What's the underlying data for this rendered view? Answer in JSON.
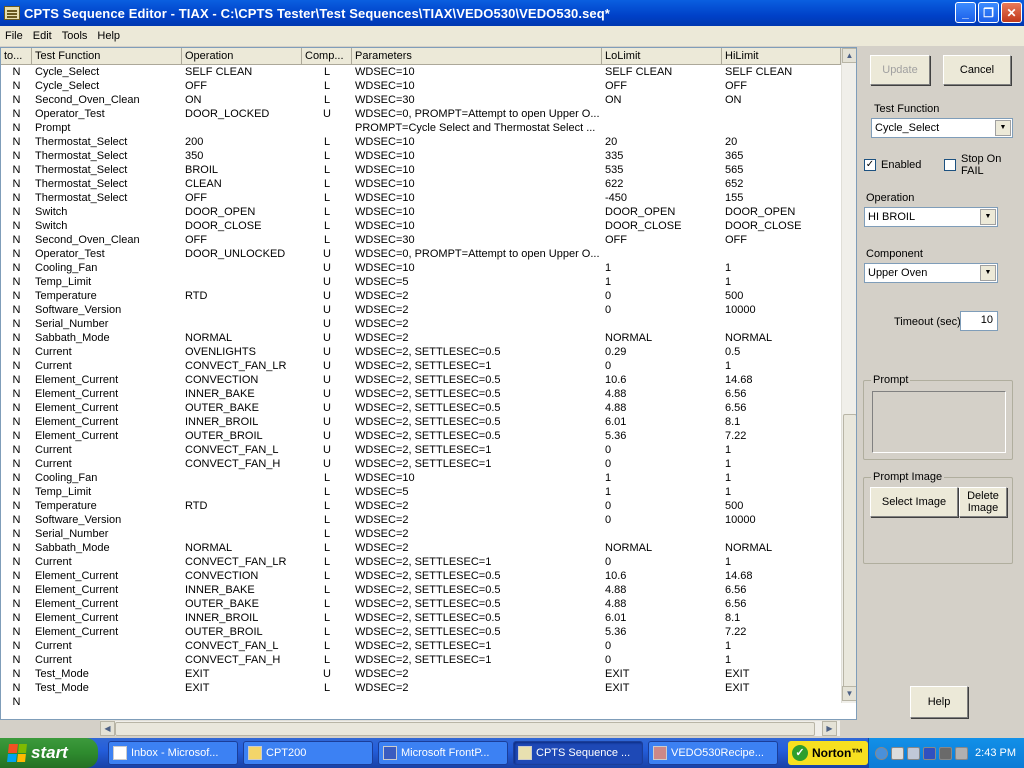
{
  "window": {
    "title": "CPTS Sequence Editor - TIAX - C:\\CPTS Tester\\Test Sequences\\TIAX\\VEDO530\\VEDO530.seq*",
    "minimize_glyph": "_",
    "maximize_glyph": "❐",
    "close_glyph": "✕"
  },
  "menu": [
    {
      "label": "File"
    },
    {
      "label": "Edit"
    },
    {
      "label": "Tools"
    },
    {
      "label": "Help"
    }
  ],
  "grid": {
    "columns": [
      "to...",
      "Test Function",
      "Operation",
      "Comp...",
      "Parameters",
      "LoLimit",
      "HiLimit"
    ],
    "rows": [
      [
        "N",
        "Cycle_Select",
        "SELF CLEAN",
        "L",
        "WDSEC=10",
        "SELF CLEAN",
        "SELF CLEAN"
      ],
      [
        "N",
        "Cycle_Select",
        "OFF",
        "L",
        "WDSEC=10",
        "OFF",
        "OFF"
      ],
      [
        "N",
        "Second_Oven_Clean",
        "ON",
        "L",
        "WDSEC=30",
        "ON",
        "ON"
      ],
      [
        "N",
        "Operator_Test",
        "DOOR_LOCKED",
        "U",
        "WDSEC=0, PROMPT=Attempt to open Upper O...",
        "",
        ""
      ],
      [
        "N",
        "Prompt",
        "",
        "",
        "PROMPT=Cycle Select and Thermostat Select ...",
        "",
        ""
      ],
      [
        "N",
        "Thermostat_Select",
        "200",
        "L",
        "WDSEC=10",
        "20",
        "20"
      ],
      [
        "N",
        "Thermostat_Select",
        "350",
        "L",
        "WDSEC=10",
        "335",
        "365"
      ],
      [
        "N",
        "Thermostat_Select",
        "BROIL",
        "L",
        "WDSEC=10",
        "535",
        "565"
      ],
      [
        "N",
        "Thermostat_Select",
        "CLEAN",
        "L",
        "WDSEC=10",
        "622",
        "652"
      ],
      [
        "N",
        "Thermostat_Select",
        "OFF",
        "L",
        "WDSEC=10",
        "-450",
        "155"
      ],
      [
        "N",
        "Switch",
        "DOOR_OPEN",
        "L",
        "WDSEC=10",
        "DOOR_OPEN",
        "DOOR_OPEN"
      ],
      [
        "N",
        "Switch",
        "DOOR_CLOSE",
        "L",
        "WDSEC=10",
        "DOOR_CLOSE",
        "DOOR_CLOSE"
      ],
      [
        "N",
        "Second_Oven_Clean",
        "OFF",
        "L",
        "WDSEC=30",
        "OFF",
        "OFF"
      ],
      [
        "N",
        "Operator_Test",
        "DOOR_UNLOCKED",
        "U",
        "WDSEC=0, PROMPT=Attempt to open Upper O...",
        "",
        ""
      ],
      [
        "N",
        "Cooling_Fan",
        "",
        "U",
        "WDSEC=10",
        "1",
        "1"
      ],
      [
        "N",
        "Temp_Limit",
        "",
        "U",
        "WDSEC=5",
        "1",
        "1"
      ],
      [
        "N",
        "Temperature",
        "RTD",
        "U",
        "WDSEC=2",
        "0",
        "500"
      ],
      [
        "N",
        "Software_Version",
        "",
        "U",
        "WDSEC=2",
        "0",
        "10000"
      ],
      [
        "N",
        "Serial_Number",
        "",
        "U",
        "WDSEC=2",
        "",
        ""
      ],
      [
        "N",
        "Sabbath_Mode",
        "NORMAL",
        "U",
        "WDSEC=2",
        "NORMAL",
        "NORMAL"
      ],
      [
        "N",
        "Current",
        "OVENLIGHTS",
        "U",
        "WDSEC=2, SETTLESEC=0.5",
        "0.29",
        "0.5"
      ],
      [
        "N",
        "Current",
        "CONVECT_FAN_LR",
        "U",
        "WDSEC=2, SETTLESEC=1",
        "0",
        "1"
      ],
      [
        "N",
        "Element_Current",
        "CONVECTION",
        "U",
        "WDSEC=2, SETTLESEC=0.5",
        "10.6",
        "14.68"
      ],
      [
        "N",
        "Element_Current",
        "INNER_BAKE",
        "U",
        "WDSEC=2, SETTLESEC=0.5",
        "4.88",
        "6.56"
      ],
      [
        "N",
        "Element_Current",
        "OUTER_BAKE",
        "U",
        "WDSEC=2, SETTLESEC=0.5",
        "4.88",
        "6.56"
      ],
      [
        "N",
        "Element_Current",
        "INNER_BROIL",
        "U",
        "WDSEC=2, SETTLESEC=0.5",
        "6.01",
        "8.1"
      ],
      [
        "N",
        "Element_Current",
        "OUTER_BROIL",
        "U",
        "WDSEC=2, SETTLESEC=0.5",
        "5.36",
        "7.22"
      ],
      [
        "N",
        "Current",
        "CONVECT_FAN_L",
        "U",
        "WDSEC=2, SETTLESEC=1",
        "0",
        "1"
      ],
      [
        "N",
        "Current",
        "CONVECT_FAN_H",
        "U",
        "WDSEC=2, SETTLESEC=1",
        "0",
        "1"
      ],
      [
        "N",
        "Cooling_Fan",
        "",
        "L",
        "WDSEC=10",
        "1",
        "1"
      ],
      [
        "N",
        "Temp_Limit",
        "",
        "L",
        "WDSEC=5",
        "1",
        "1"
      ],
      [
        "N",
        "Temperature",
        "RTD",
        "L",
        "WDSEC=2",
        "0",
        "500"
      ],
      [
        "N",
        "Software_Version",
        "",
        "L",
        "WDSEC=2",
        "0",
        "10000"
      ],
      [
        "N",
        "Serial_Number",
        "",
        "L",
        "WDSEC=2",
        "",
        ""
      ],
      [
        "N",
        "Sabbath_Mode",
        "NORMAL",
        "L",
        "WDSEC=2",
        "NORMAL",
        "NORMAL"
      ],
      [
        "N",
        "Current",
        "CONVECT_FAN_LR",
        "L",
        "WDSEC=2, SETTLESEC=1",
        "0",
        "1"
      ],
      [
        "N",
        "Element_Current",
        "CONVECTION",
        "L",
        "WDSEC=2, SETTLESEC=0.5",
        "10.6",
        "14.68"
      ],
      [
        "N",
        "Element_Current",
        "INNER_BAKE",
        "L",
        "WDSEC=2, SETTLESEC=0.5",
        "4.88",
        "6.56"
      ],
      [
        "N",
        "Element_Current",
        "OUTER_BAKE",
        "L",
        "WDSEC=2, SETTLESEC=0.5",
        "4.88",
        "6.56"
      ],
      [
        "N",
        "Element_Current",
        "INNER_BROIL",
        "L",
        "WDSEC=2, SETTLESEC=0.5",
        "6.01",
        "8.1"
      ],
      [
        "N",
        "Element_Current",
        "OUTER_BROIL",
        "L",
        "WDSEC=2, SETTLESEC=0.5",
        "5.36",
        "7.22"
      ],
      [
        "N",
        "Current",
        "CONVECT_FAN_L",
        "L",
        "WDSEC=2, SETTLESEC=1",
        "0",
        "1"
      ],
      [
        "N",
        "Current",
        "CONVECT_FAN_H",
        "L",
        "WDSEC=2, SETTLESEC=1",
        "0",
        "1"
      ],
      [
        "N",
        "Test_Mode",
        "EXIT",
        "U",
        "WDSEC=2",
        "EXIT",
        "EXIT"
      ],
      [
        "N",
        "Test_Mode",
        "EXIT",
        "L",
        "WDSEC=2",
        "EXIT",
        "EXIT"
      ],
      [
        "N",
        "",
        "",
        "",
        "",
        "",
        ""
      ]
    ]
  },
  "panel": {
    "update_label": "Update",
    "cancel_label": "Cancel",
    "test_function_label": "Test Function",
    "test_function_value": "Cycle_Select",
    "enabled_label": "Enabled",
    "enabled_checked": true,
    "stop_on_fail_label": "Stop On FAIL",
    "stop_on_fail_checked": false,
    "operation_label": "Operation",
    "operation_value": "HI BROIL",
    "component_label": "Component",
    "component_value": "Upper Oven",
    "timeout_label": "Timeout (sec)",
    "timeout_value": "10",
    "prompt_label": "Prompt",
    "prompt_image_label": "Prompt Image",
    "select_image_label": "Select Image",
    "delete_image_label": "Delete Image",
    "help_label": "Help"
  },
  "taskbar": {
    "start_label": "start",
    "tasks": [
      {
        "label": "Inbox - Microsof..."
      },
      {
        "label": "CPT200"
      },
      {
        "label": "Microsoft FrontP..."
      },
      {
        "label": "CPTS Sequence ..."
      },
      {
        "label": "VEDO530Recipe..."
      }
    ],
    "norton_label": "Norton™",
    "clock": "2:43 PM"
  },
  "icons": {
    "check_glyph": "✓",
    "dropdown_glyph": "▼",
    "scroll_up_glyph": "▲",
    "scroll_down_glyph": "▼",
    "scroll_left_glyph": "◀",
    "scroll_right_glyph": "▶"
  }
}
